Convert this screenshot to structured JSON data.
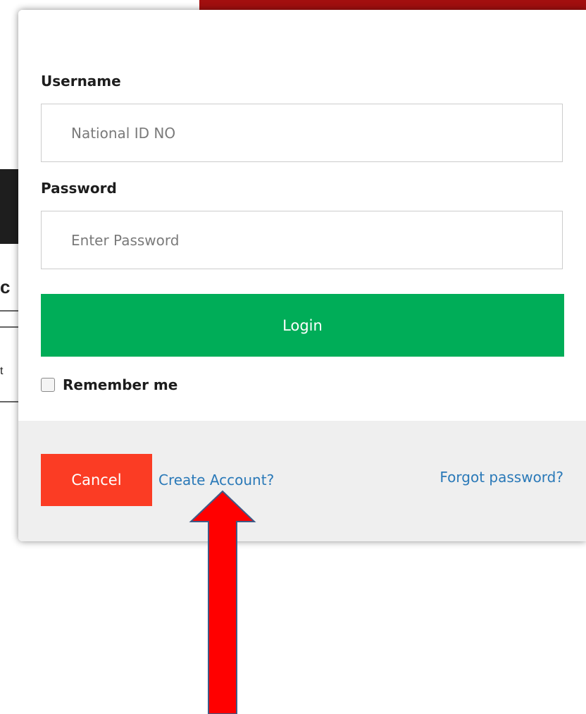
{
  "login": {
    "username_label": "Username",
    "username_placeholder": "National ID NO",
    "username_value": "",
    "password_label": "Password",
    "password_placeholder": "Enter Password",
    "password_value": "",
    "login_label": "Login",
    "remember_label": "Remember me",
    "remember_checked": false
  },
  "footer": {
    "cancel_label": "Cancel",
    "create_account_label": "Create Account?",
    "forgot_password_label": "Forgot password?"
  },
  "colors": {
    "login_button": "#00ad58",
    "cancel_button": "#fb3c24",
    "link": "#2a79b8",
    "footer_background": "#efefef",
    "annotation_arrow": "#ff0000"
  },
  "icons": {
    "annotation": "arrow-up-icon",
    "checkbox": "checkbox-icon"
  }
}
